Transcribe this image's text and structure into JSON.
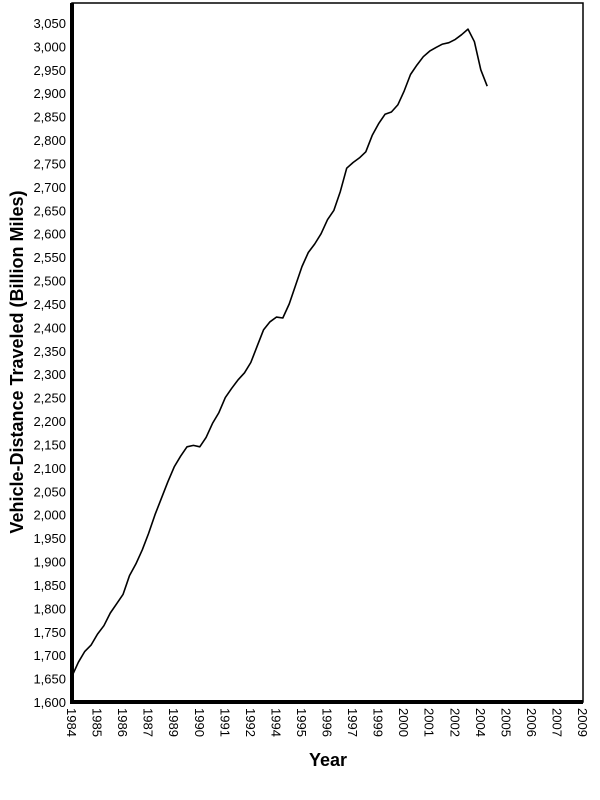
{
  "chart_data": {
    "type": "line",
    "title": "",
    "xlabel": "Year",
    "ylabel": "Vehicle-Distance Traveled (Billion Miles)",
    "ylim": [
      1600,
      3050
    ],
    "y_ticks": [
      "1,600",
      "1,650",
      "1,700",
      "1,750",
      "1,800",
      "1,850",
      "1,900",
      "1,950",
      "2,000",
      "2,050",
      "2,100",
      "2,150",
      "2,200",
      "2,250",
      "2,300",
      "2,350",
      "2,400",
      "2,450",
      "2,500",
      "2,550",
      "2,600",
      "2,650",
      "2,700",
      "2,750",
      "2,800",
      "2,850",
      "2,900",
      "2,950",
      "3,000",
      "3,050"
    ],
    "y_tick_values": [
      1600,
      1650,
      1700,
      1750,
      1800,
      1850,
      1900,
      1950,
      2000,
      2050,
      2100,
      2150,
      2200,
      2250,
      2300,
      2350,
      2400,
      2450,
      2500,
      2550,
      2600,
      2650,
      2700,
      2750,
      2800,
      2850,
      2900,
      2950,
      3000,
      3050
    ],
    "x_ticks": [
      "1984",
      "1985",
      "1986",
      "1987",
      "1989",
      "1990",
      "1991",
      "1992",
      "1994",
      "1995",
      "1996",
      "1997",
      "1999",
      "2000",
      "2001",
      "2002",
      "2004",
      "2005",
      "2006",
      "2007",
      "2009"
    ],
    "grid": false,
    "legend": "none",
    "series": [
      {
        "name": "Vehicle-Distance Traveled",
        "color": "#000000",
        "x": [
          0,
          0.25,
          0.5,
          0.75,
          1,
          1.25,
          1.5,
          1.75,
          2,
          2.25,
          2.5,
          2.75,
          3,
          3.25,
          3.5,
          3.75,
          4,
          4.25,
          4.5,
          4.75,
          5,
          5.25,
          5.5,
          5.75,
          6,
          6.25,
          6.5,
          6.75,
          7,
          7.25,
          7.5,
          7.75,
          8,
          8.25,
          8.5,
          8.75,
          9,
          9.25,
          9.5,
          9.75,
          10,
          10.25,
          10.5,
          10.75,
          11,
          11.25,
          11.5,
          11.75,
          12,
          12.25,
          12.5,
          12.75,
          13,
          13.25,
          13.5,
          13.75,
          14,
          14.25,
          14.5,
          14.75,
          15,
          15.25,
          15.5,
          15.75,
          16,
          16.25,
          16.5,
          16.75,
          17,
          17.25,
          17.5,
          17.75,
          18,
          18.25,
          18.5,
          18.75,
          19,
          19.25,
          19.5,
          19.75,
          20
        ],
        "values": [
          1655,
          1685,
          1708,
          1722,
          1745,
          1763,
          1790,
          1810,
          1830,
          1870,
          1895,
          1925,
          1960,
          2000,
          2035,
          2070,
          2102,
          2125,
          2145,
          2148,
          2145,
          2165,
          2195,
          2218,
          2250,
          2270,
          2288,
          2303,
          2325,
          2360,
          2395,
          2412,
          2422,
          2420,
          2450,
          2490,
          2530,
          2560,
          2578,
          2600,
          2630,
          2650,
          2690,
          2740,
          2752,
          2762,
          2775,
          2810,
          2835,
          2855,
          2860,
          2875,
          2905,
          2940,
          2960,
          2978,
          2990,
          2998,
          3005,
          3008,
          3015,
          3025,
          3037,
          3010,
          2950,
          2915
        ]
      }
    ]
  }
}
